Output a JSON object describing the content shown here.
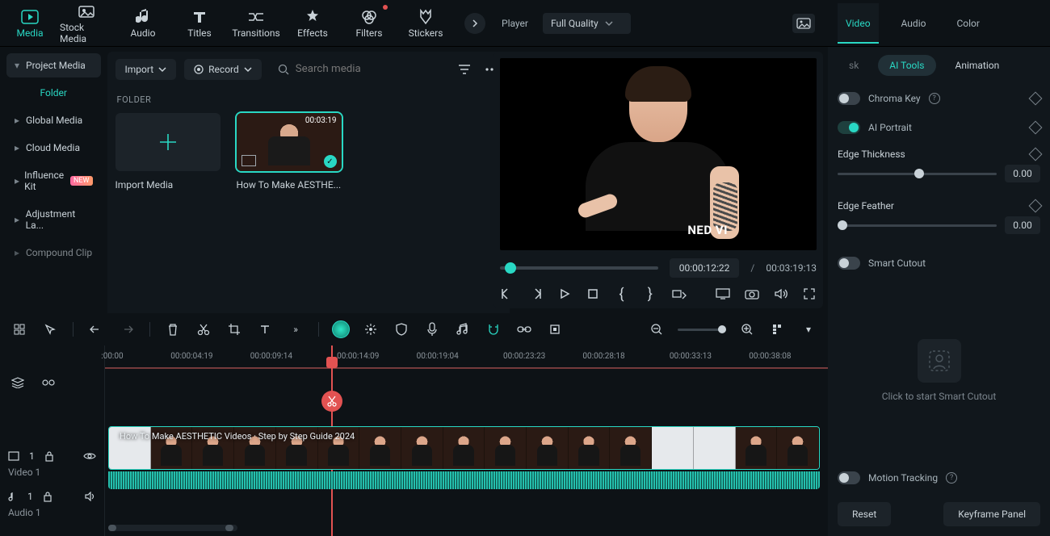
{
  "topTabs": {
    "media": "Media",
    "stockMedia": "Stock Media",
    "audio": "Audio",
    "titles": "Titles",
    "transitions": "Transitions",
    "effects": "Effects",
    "filters": "Filters",
    "stickers": "Stickers"
  },
  "playerHeader": {
    "label": "Player",
    "quality": "Full Quality"
  },
  "propTabs": {
    "video": "Video",
    "audio": "Audio",
    "color": "Color"
  },
  "sidebar": {
    "projectMedia": "Project Media",
    "folder": "Folder",
    "globalMedia": "Global Media",
    "cloudMedia": "Cloud Media",
    "influenceKit": "Influence Kit",
    "influenceBadge": "NEW",
    "adjustmentLayer": "Adjustment La...",
    "compoundClip": "Compound Clip"
  },
  "mediaToolbar": {
    "import": "Import",
    "record": "Record",
    "searchPlaceholder": "Search media"
  },
  "folderLabel": "FOLDER",
  "thumbs": {
    "importMedia": "Import Media",
    "clip1": {
      "caption": "How To Make AESTHE...",
      "duration": "00:03:19"
    }
  },
  "viewportOverlay": "NED VI",
  "playback": {
    "current": "00:00:12:22",
    "total": "00:03:19:13",
    "separator": "/"
  },
  "subTabs": {
    "sk": "sk",
    "aiTools": "AI Tools",
    "animation": "Animation"
  },
  "props": {
    "chromaKey": "Chroma Key",
    "aiPortrait": "AI Portrait",
    "edgeThickness": "Edge Thickness",
    "edgeThicknessVal": "0.00",
    "edgeFeather": "Edge Feather",
    "edgeFeatherVal": "0.00",
    "smartCutout": "Smart Cutout",
    "smartCutoutHint": "Click to start Smart Cutout",
    "motionTracking": "Motion Tracking"
  },
  "propFooter": {
    "reset": "Reset",
    "keyframePanel": "Keyframe Panel"
  },
  "ruler": [
    ":00:00",
    "00:00:04:19",
    "00:00:09:14",
    "00:00:14:09",
    "00:00:19:04",
    "00:00:23:23",
    "00:00:28:18",
    "00:00:33:13",
    "00:00:38:08"
  ],
  "tracks": {
    "videoNum": "1",
    "videoLabel": "Video 1",
    "audioNum": "1",
    "audioLabel": "Audio 1",
    "clipOverlay": "How To Make AESTHETIC Videos · Step by Step Guide 2024"
  }
}
